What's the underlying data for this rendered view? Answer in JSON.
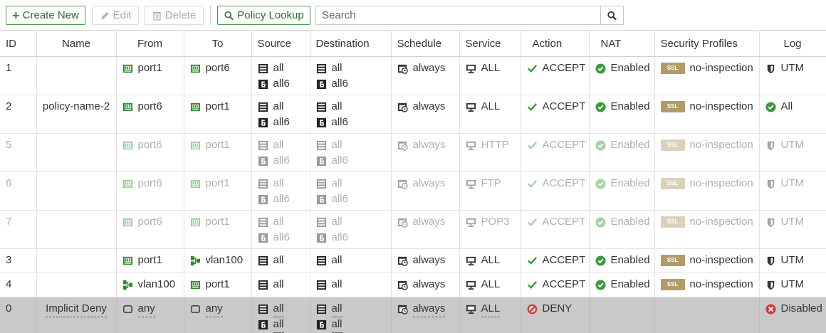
{
  "toolbar": {
    "create_new": "Create New",
    "edit": "Edit",
    "delete": "Delete",
    "policy_lookup": "Policy Lookup",
    "search_placeholder": "Search"
  },
  "columns": {
    "id": "ID",
    "name": "Name",
    "from": "From",
    "to": "To",
    "source": "Source",
    "destination": "Destination",
    "schedule": "Schedule",
    "service": "Service",
    "action": "Action",
    "nat": "NAT",
    "security_profiles": "Security Profiles",
    "log": "Log"
  },
  "rows": [
    {
      "id": "1",
      "name": "",
      "from": "port1",
      "to": "port6",
      "src1": "all",
      "src2": "all6",
      "dst1": "all",
      "dst2": "all6",
      "schedule": "always",
      "service": "ALL",
      "action": "ACCEPT",
      "nat": "Enabled",
      "profile": "no-inspection",
      "log": "UTM"
    },
    {
      "id": "2",
      "name": "policy-name-2",
      "from": "port6",
      "to": "port1",
      "src1": "all",
      "src2": "all6",
      "dst1": "all",
      "dst2": "all6",
      "schedule": "always",
      "service": "ALL",
      "action": "ACCEPT",
      "nat": "Enabled",
      "profile": "no-inspection",
      "log": "All"
    },
    {
      "id": "5",
      "name": "",
      "from": "port6",
      "to": "port1",
      "src1": "all",
      "src2": "all6",
      "dst1": "all",
      "dst2": "all6",
      "schedule": "always",
      "service": "HTTP",
      "action": "ACCEPT",
      "nat": "Enabled",
      "profile": "no-inspection",
      "log": "UTM"
    },
    {
      "id": "6",
      "name": "",
      "from": "port6",
      "to": "port1",
      "src1": "all",
      "src2": "all6",
      "dst1": "all",
      "dst2": "all6",
      "schedule": "always",
      "service": "FTP",
      "action": "ACCEPT",
      "nat": "Enabled",
      "profile": "no-inspection",
      "log": "UTM"
    },
    {
      "id": "7",
      "name": "",
      "from": "port6",
      "to": "port1",
      "src1": "all",
      "src2": "all6",
      "dst1": "all",
      "dst2": "all6",
      "schedule": "always",
      "service": "POP3",
      "action": "ACCEPT",
      "nat": "Enabled",
      "profile": "no-inspection",
      "log": "UTM"
    },
    {
      "id": "3",
      "name": "",
      "from": "port1",
      "to": "vlan100",
      "src1": "all",
      "dst1": "all",
      "schedule": "always",
      "service": "ALL",
      "action": "ACCEPT",
      "nat": "Enabled",
      "profile": "no-inspection",
      "log": "UTM"
    },
    {
      "id": "4",
      "name": "",
      "from": "vlan100",
      "to": "port1",
      "src1": "all",
      "dst1": "all",
      "schedule": "always",
      "service": "ALL",
      "action": "ACCEPT",
      "nat": "Enabled",
      "profile": "no-inspection",
      "log": "UTM"
    },
    {
      "id": "0",
      "name": "Implicit Deny",
      "from": "any",
      "to": "any",
      "src1": "all",
      "src2": "all",
      "dst1": "all",
      "dst2": "all",
      "schedule": "always",
      "service": "ALL",
      "action": "DENY",
      "log": "Disabled"
    }
  ],
  "ssl_badge": "SSL",
  "ipv6_badge": "6",
  "colors": {
    "accent_green": "#3b8a3b",
    "interface_green": "#2f8a2f",
    "deny_red": "#d23a3a",
    "ssl_badge": "#b19a6b",
    "implicit_row_bg": "#c9c9c9",
    "disabled_text": "#b0b0b0"
  },
  "icons": {
    "create": "plus-icon",
    "edit": "pencil-icon",
    "delete": "trash-icon",
    "lookup": "search-icon",
    "interface": "port-icon",
    "vlan": "vlan-icon",
    "any": "any-interface-icon",
    "address": "address-icon",
    "ipv6": "ipv6-address-icon",
    "schedule": "schedule-icon",
    "service": "service-icon",
    "accept": "check-icon",
    "deny": "deny-icon",
    "nat_enabled": "check-circle-icon",
    "log": "shield-icon",
    "log_all": "check-circle-icon",
    "log_disabled": "x-circle-icon"
  }
}
